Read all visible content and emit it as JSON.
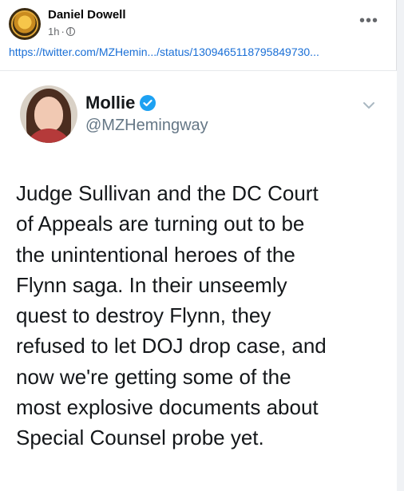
{
  "post": {
    "author": "Daniel Dowell",
    "time": "1h",
    "separator": "·",
    "more_label": "•••",
    "link": "https://twitter.com/MZHemin.../status/1309465118795849730..."
  },
  "tweet": {
    "name": "Mollie",
    "handle": "@MZHemingway",
    "lines": [
      "Judge Sullivan and the DC Court",
      "of Appeals are turning out to be",
      "the unintentional heroes of the",
      "Flynn saga. In their unseemly",
      "quest to destroy Flynn, they",
      "refused to let DOJ drop case, and",
      "now we're getting some of the",
      "most explosive documents about",
      "Special Counsel probe yet."
    ]
  },
  "colors": {
    "link": "#1a6fd6",
    "verified": "#1da1f2",
    "meta": "#65676b"
  },
  "icons": [
    "globe-icon",
    "more-icon",
    "verified-icon",
    "chevron-down-icon"
  ]
}
